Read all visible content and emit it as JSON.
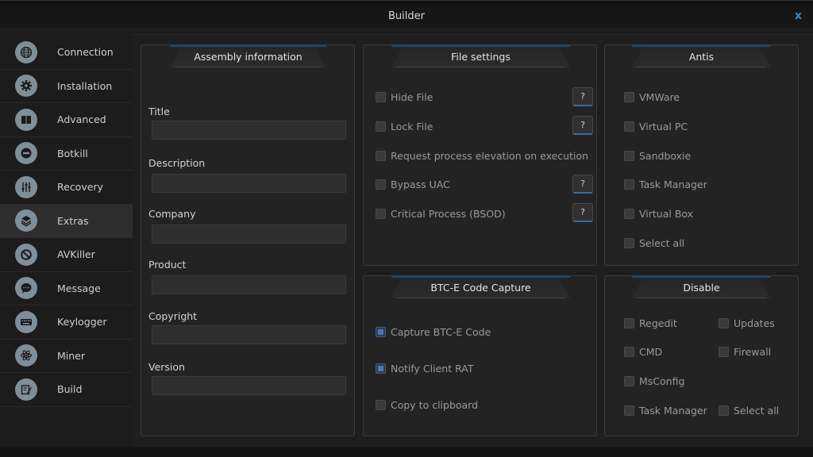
{
  "window": {
    "title": "Builder",
    "close_label": "x"
  },
  "sidebar": {
    "items": [
      {
        "label": "Connection",
        "icon": "globe-icon"
      },
      {
        "label": "Installation",
        "icon": "gear-icon"
      },
      {
        "label": "Advanced",
        "icon": "book-icon"
      },
      {
        "label": "Botkill",
        "icon": "minus-circle-icon"
      },
      {
        "label": "Recovery",
        "icon": "sliders-icon"
      },
      {
        "label": "Extras",
        "icon": "layers-icon"
      },
      {
        "label": "AVKiller",
        "icon": "ban-icon"
      },
      {
        "label": "Message",
        "icon": "chat-icon"
      },
      {
        "label": "Keylogger",
        "icon": "keyboard-icon"
      },
      {
        "label": "Miner",
        "icon": "atom-icon"
      },
      {
        "label": "Build",
        "icon": "edit-icon"
      }
    ],
    "active": "Extras"
  },
  "assembly": {
    "title": "Assembly information",
    "fields": [
      {
        "label": "Title",
        "value": ""
      },
      {
        "label": "Description",
        "value": ""
      },
      {
        "label": "Company",
        "value": ""
      },
      {
        "label": "Product",
        "value": ""
      },
      {
        "label": "Copyright",
        "value": ""
      },
      {
        "label": "Version",
        "value": ""
      }
    ]
  },
  "file_settings": {
    "title": "File settings",
    "options": [
      {
        "label": "Hide File",
        "checked": false,
        "help": "?"
      },
      {
        "label": "Lock File",
        "checked": false,
        "help": "?"
      },
      {
        "label": "Request process elevation on execution",
        "checked": false
      },
      {
        "label": "Bypass UAC",
        "checked": false,
        "help": "?"
      },
      {
        "label": "Critical Process (BSOD)",
        "checked": false,
        "help": "?"
      }
    ]
  },
  "antis": {
    "title": "Antis",
    "options": [
      {
        "label": "VMWare",
        "checked": false
      },
      {
        "label": "Virtual PC",
        "checked": false
      },
      {
        "label": "Sandboxie",
        "checked": false
      },
      {
        "label": "Task Manager",
        "checked": false
      },
      {
        "label": "Virtual Box",
        "checked": false
      },
      {
        "label": "Select all",
        "checked": false
      }
    ]
  },
  "btce": {
    "title": "BTC-E Code Capture",
    "options": [
      {
        "label": "Capture BTC-E Code",
        "checked": true
      },
      {
        "label": "Notify Client RAT",
        "checked": true
      },
      {
        "label": "Copy to clipboard",
        "checked": false
      }
    ]
  },
  "disable": {
    "title": "Disable",
    "left": [
      {
        "label": "Regedit",
        "checked": false
      },
      {
        "label": "CMD",
        "checked": false
      },
      {
        "label": "MsConfig",
        "checked": false
      },
      {
        "label": "Task Manager",
        "checked": false
      }
    ],
    "right": [
      {
        "label": "Updates",
        "checked": false
      },
      {
        "label": "Firewall",
        "checked": false
      },
      {
        "label": "Select all",
        "checked": false
      }
    ]
  },
  "colors": {
    "accent": "#2e86c7",
    "background": "#1c1c1c",
    "panel": "#232323"
  }
}
